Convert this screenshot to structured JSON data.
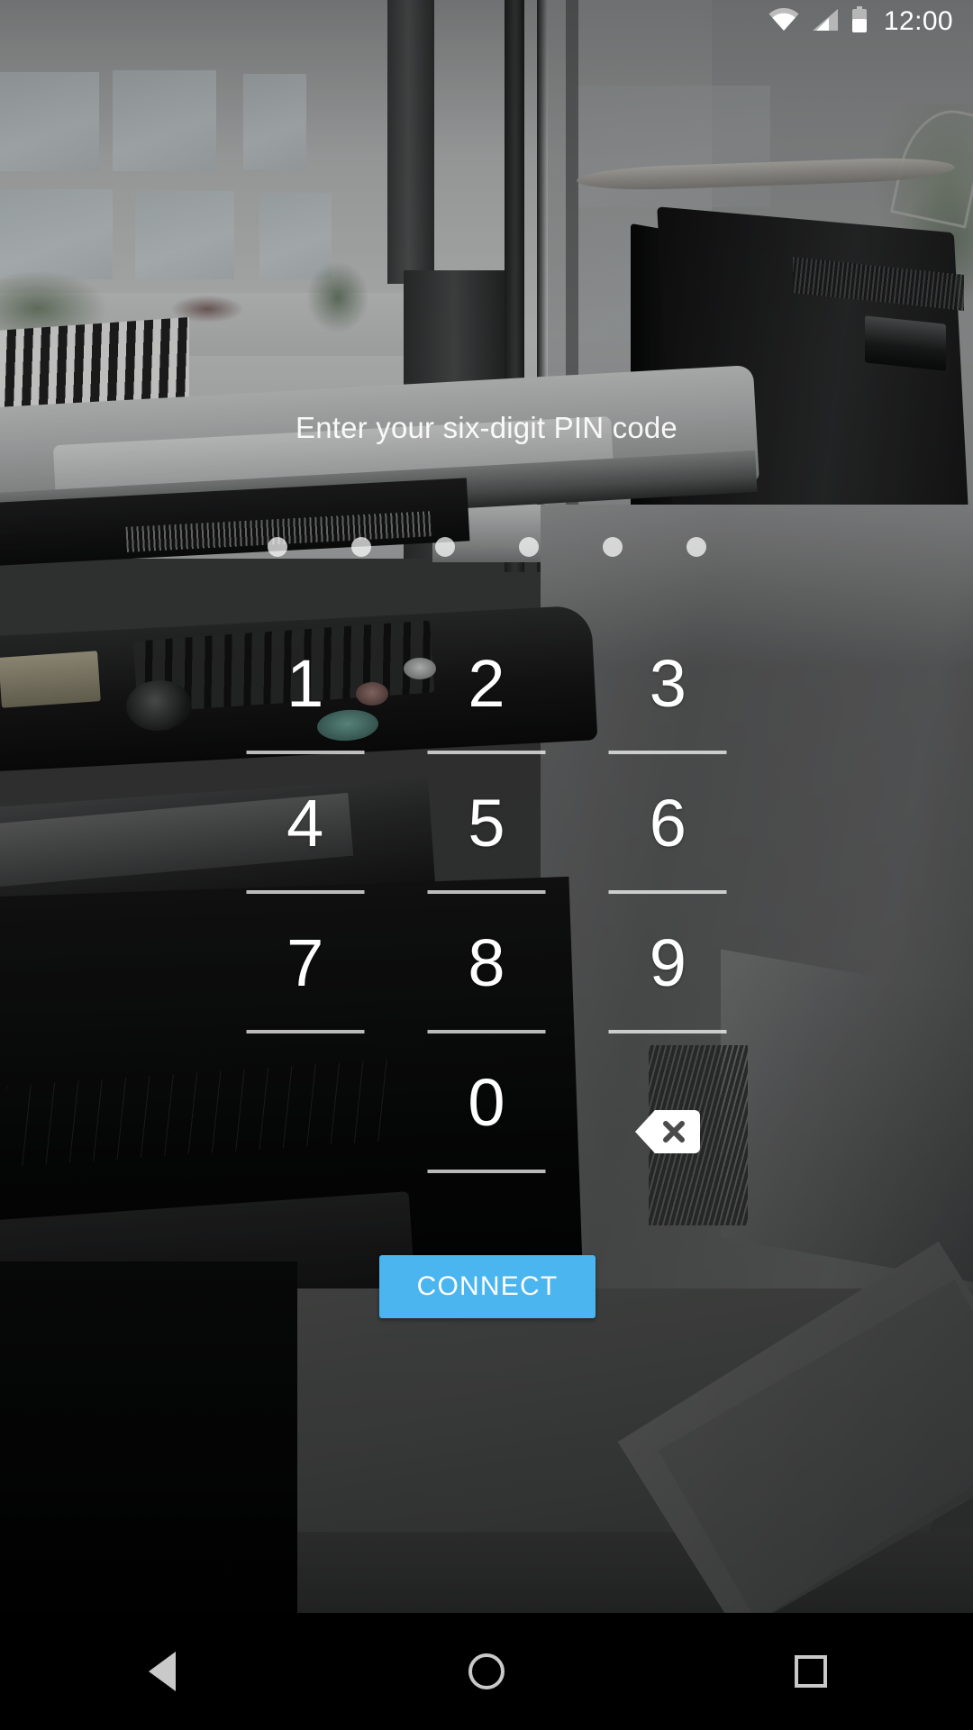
{
  "status_bar": {
    "clock": "12:00",
    "icons": [
      {
        "name": "wifi-icon",
        "label": "Wi-Fi connected"
      },
      {
        "name": "cellular-signal-icon",
        "label": "Cellular signal"
      },
      {
        "name": "battery-icon",
        "label": "Battery"
      }
    ]
  },
  "screen": {
    "prompt": "Enter your six-digit PIN code",
    "pin": {
      "length": 6,
      "entered": 0,
      "dot_color": "#ffffff"
    }
  },
  "keypad": {
    "keys": [
      {
        "name": "key-1",
        "label": "1"
      },
      {
        "name": "key-2",
        "label": "2"
      },
      {
        "name": "key-3",
        "label": "3"
      },
      {
        "name": "key-4",
        "label": "4"
      },
      {
        "name": "key-5",
        "label": "5"
      },
      {
        "name": "key-6",
        "label": "6"
      },
      {
        "name": "key-7",
        "label": "7"
      },
      {
        "name": "key-8",
        "label": "8"
      },
      {
        "name": "key-9",
        "label": "9"
      },
      {
        "name": "key-blank",
        "label": ""
      },
      {
        "name": "key-0",
        "label": "0"
      },
      {
        "name": "key-backspace",
        "label": ""
      }
    ],
    "backspace_icon": "backspace-icon"
  },
  "actions": {
    "connect_label": "CONNECT",
    "connect_color": "#4AB5EF"
  },
  "nav_bar": {
    "back": "back-icon",
    "home": "home-icon",
    "recents": "recents-icon"
  },
  "theme": {
    "accent": "#4AB5EF",
    "text_on_photo": "#FFFFFF",
    "nav_bar_bg": "#000000",
    "nav_icon": "#C9C9C9"
  }
}
